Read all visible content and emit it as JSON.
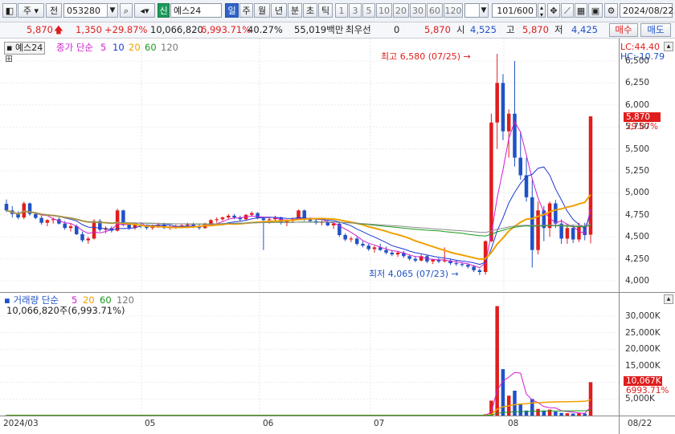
{
  "toolbar": {
    "mode": "주",
    "market": "전",
    "code": "053280",
    "new_badge": "신",
    "stock_name": "예스24",
    "periods": [
      "일",
      "주",
      "월",
      "년",
      "분",
      "초",
      "틱"
    ],
    "active_period": "일",
    "intervals": [
      "1",
      "3",
      "5",
      "10",
      "20",
      "30",
      "60",
      "120"
    ],
    "count": "101/600",
    "date": "2024/08/22"
  },
  "quote": {
    "price": "5,870",
    "change": "1,350",
    "change_pct": "+29.87%",
    "volume": "10,066,820",
    "volume_pct": "6,993.71%",
    "turnover": "40.27%",
    "amount": "55,019백만",
    "priority_label": "최우선",
    "priority_value": "0",
    "ask": "5,870",
    "open_label": "시",
    "open": "4,525",
    "high_label": "고",
    "high": "5,870",
    "low_label": "저",
    "low": "4,425",
    "buy_label": "매수",
    "sell_label": "매도"
  },
  "price_panel": {
    "name_tag": "예스24",
    "legend_prefix": "종가 단순",
    "ma_labels": [
      "5",
      "10",
      "20",
      "60",
      "120"
    ],
    "lc": "LC:44.40",
    "hc": "HC:-10.79",
    "last_price_box": "5,870",
    "last_pct": "29.87%",
    "high_annotation": "최고 6,580 (07/25)",
    "low_annotation": "최저 4,065 (07/23)",
    "y_ticks": [
      "6,500",
      "6,250",
      "6,000",
      "5,750",
      "5,500",
      "5,250",
      "5,000",
      "4,750",
      "4,500",
      "4,250",
      "4,000"
    ]
  },
  "volume_panel": {
    "legend_prefix": "거래량 단순",
    "ma_labels": [
      "5",
      "20",
      "60",
      "120"
    ],
    "info": "10,066,820주(6,993.71%)",
    "last_vol_box": "10,067K",
    "last_vol_pct": "6993.71%",
    "y_ticks": [
      "30,000K",
      "25,000K",
      "20,000K",
      "15,000K",
      "10,000K",
      "5,000K"
    ]
  },
  "x_axis": {
    "labels": [
      "2024/03",
      "05",
      "06",
      "07",
      "08"
    ],
    "right_label": "08/22"
  },
  "colors": {
    "up": "#e01d1d",
    "down": "#1f52c6",
    "ma5": "#d21ed2",
    "ma10": "#1e3ad2",
    "ma20": "#f0a000",
    "ma60": "#1a9a1a",
    "ma120": "#8a8a8a"
  },
  "chart_data": {
    "type": "candlestick",
    "price_range": [
      3950,
      6600
    ],
    "candles_ohlc": [
      [
        4875,
        4925,
        4780,
        4800
      ],
      [
        4800,
        4850,
        4720,
        4760
      ],
      [
        4760,
        4790,
        4700,
        4720
      ],
      [
        4720,
        4900,
        4700,
        4880
      ],
      [
        4880,
        4890,
        4740,
        4760
      ],
      [
        4760,
        4780,
        4700,
        4715
      ],
      [
        4715,
        4740,
        4640,
        4660
      ],
      [
        4660,
        4700,
        4620,
        4690
      ],
      [
        4690,
        4720,
        4650,
        4700
      ],
      [
        4700,
        4720,
        4640,
        4650
      ],
      [
        4650,
        4680,
        4580,
        4600
      ],
      [
        4600,
        4650,
        4560,
        4620
      ],
      [
        4620,
        4640,
        4520,
        4530
      ],
      [
        4530,
        4560,
        4440,
        4460
      ],
      [
        4460,
        4500,
        4420,
        4480
      ],
      [
        4480,
        4700,
        4470,
        4680
      ],
      [
        4680,
        4700,
        4560,
        4580
      ],
      [
        4580,
        4620,
        4540,
        4600
      ],
      [
        4600,
        4620,
        4550,
        4570
      ],
      [
        4570,
        4820,
        4560,
        4800
      ],
      [
        4800,
        4810,
        4620,
        4640
      ],
      [
        4640,
        4660,
        4580,
        4600
      ],
      [
        4600,
        4650,
        4580,
        4640
      ],
      [
        4640,
        4660,
        4600,
        4620
      ],
      [
        4620,
        4640,
        4580,
        4600
      ],
      [
        4600,
        4640,
        4580,
        4620
      ],
      [
        4620,
        4660,
        4600,
        4640
      ],
      [
        4640,
        4660,
        4590,
        4600
      ],
      [
        4600,
        4630,
        4580,
        4610
      ],
      [
        4610,
        4640,
        4590,
        4620
      ],
      [
        4620,
        4650,
        4600,
        4630
      ],
      [
        4630,
        4660,
        4610,
        4640
      ],
      [
        4640,
        4660,
        4600,
        4610
      ],
      [
        4610,
        4640,
        4580,
        4600
      ],
      [
        4600,
        4660,
        4590,
        4650
      ],
      [
        4650,
        4700,
        4640,
        4690
      ],
      [
        4690,
        4720,
        4660,
        4700
      ],
      [
        4700,
        4730,
        4680,
        4720
      ],
      [
        4720,
        4760,
        4700,
        4740
      ],
      [
        4740,
        4760,
        4700,
        4720
      ],
      [
        4720,
        4740,
        4680,
        4700
      ],
      [
        4700,
        4760,
        4690,
        4750
      ],
      [
        4750,
        4790,
        4730,
        4770
      ],
      [
        4770,
        4780,
        4700,
        4710
      ],
      [
        4710,
        4720,
        4350,
        4690
      ],
      [
        4690,
        4720,
        4650,
        4700
      ],
      [
        4700,
        4740,
        4680,
        4720
      ],
      [
        4720,
        4730,
        4640,
        4660
      ],
      [
        4660,
        4700,
        4620,
        4680
      ],
      [
        4680,
        4720,
        4660,
        4700
      ],
      [
        4700,
        4810,
        4690,
        4800
      ],
      [
        4800,
        4810,
        4680,
        4700
      ],
      [
        4700,
        4720,
        4660,
        4680
      ],
      [
        4680,
        4700,
        4640,
        4660
      ],
      [
        4660,
        4690,
        4630,
        4670
      ],
      [
        4670,
        4690,
        4620,
        4630
      ],
      [
        4630,
        4660,
        4590,
        4650
      ],
      [
        4650,
        4660,
        4500,
        4520
      ],
      [
        4520,
        4540,
        4450,
        4470
      ],
      [
        4470,
        4500,
        4440,
        4480
      ],
      [
        4480,
        4500,
        4400,
        4420
      ],
      [
        4420,
        4450,
        4380,
        4400
      ],
      [
        4400,
        4420,
        4340,
        4360
      ],
      [
        4360,
        4400,
        4320,
        4380
      ],
      [
        4380,
        4420,
        4340,
        4350
      ],
      [
        4350,
        4390,
        4300,
        4320
      ],
      [
        4320,
        4350,
        4280,
        4300
      ],
      [
        4300,
        4340,
        4270,
        4320
      ],
      [
        4320,
        4340,
        4260,
        4280
      ],
      [
        4280,
        4300,
        4230,
        4250
      ],
      [
        4250,
        4280,
        4210,
        4230
      ],
      [
        4230,
        4300,
        4220,
        4280
      ],
      [
        4280,
        4290,
        4200,
        4220
      ],
      [
        4220,
        4250,
        4190,
        4240
      ],
      [
        4240,
        4260,
        4200,
        4220
      ],
      [
        4220,
        4380,
        4210,
        4230
      ],
      [
        4230,
        4250,
        4180,
        4200
      ],
      [
        4200,
        4230,
        4170,
        4190
      ],
      [
        4190,
        4210,
        4160,
        4180
      ],
      [
        4180,
        4200,
        4140,
        4160
      ],
      [
        4160,
        4180,
        4100,
        4120
      ],
      [
        4120,
        4140,
        4065,
        4100
      ],
      [
        4100,
        4460,
        4070,
        4450
      ],
      [
        4450,
        5900,
        4440,
        5800
      ],
      [
        5800,
        6580,
        5500,
        6250
      ],
      [
        6250,
        6350,
        5600,
        5700
      ],
      [
        5700,
        5950,
        5400,
        5900
      ],
      [
        5900,
        6500,
        5300,
        5400
      ],
      [
        5400,
        5700,
        5150,
        5200
      ],
      [
        5200,
        5400,
        4900,
        4950
      ],
      [
        4950,
        5150,
        4150,
        4350
      ],
      [
        4350,
        4900,
        4300,
        4800
      ],
      [
        4800,
        4850,
        4450,
        4600
      ],
      [
        4600,
        4900,
        4500,
        4880
      ],
      [
        4880,
        4920,
        4600,
        4650
      ],
      [
        4650,
        4700,
        4420,
        4480
      ],
      [
        4480,
        4650,
        4420,
        4600
      ],
      [
        4600,
        4640,
        4430,
        4470
      ],
      [
        4470,
        4660,
        4440,
        4620
      ],
      [
        4620,
        4660,
        4460,
        4520
      ],
      [
        4525,
        5870,
        4425,
        5870
      ]
    ],
    "volume_k": [
      80,
      70,
      60,
      90,
      60,
      50,
      60,
      50,
      40,
      50,
      60,
      50,
      70,
      80,
      50,
      120,
      80,
      60,
      50,
      130,
      90,
      60,
      50,
      40,
      40,
      40,
      50,
      40,
      40,
      40,
      40,
      50,
      40,
      40,
      50,
      60,
      50,
      50,
      60,
      40,
      40,
      60,
      70,
      60,
      90,
      40,
      40,
      50,
      40,
      40,
      80,
      60,
      40,
      40,
      40,
      40,
      40,
      70,
      60,
      40,
      50,
      40,
      50,
      40,
      40,
      40,
      40,
      40,
      40,
      40,
      40,
      50,
      40,
      40,
      40,
      60,
      40,
      40,
      40,
      40,
      50,
      60,
      400,
      4500,
      33000,
      14000,
      6000,
      7500,
      3500,
      1500,
      5000,
      2000,
      1500,
      1800,
      1200,
      800,
      700,
      600,
      700,
      600,
      10067
    ]
  }
}
